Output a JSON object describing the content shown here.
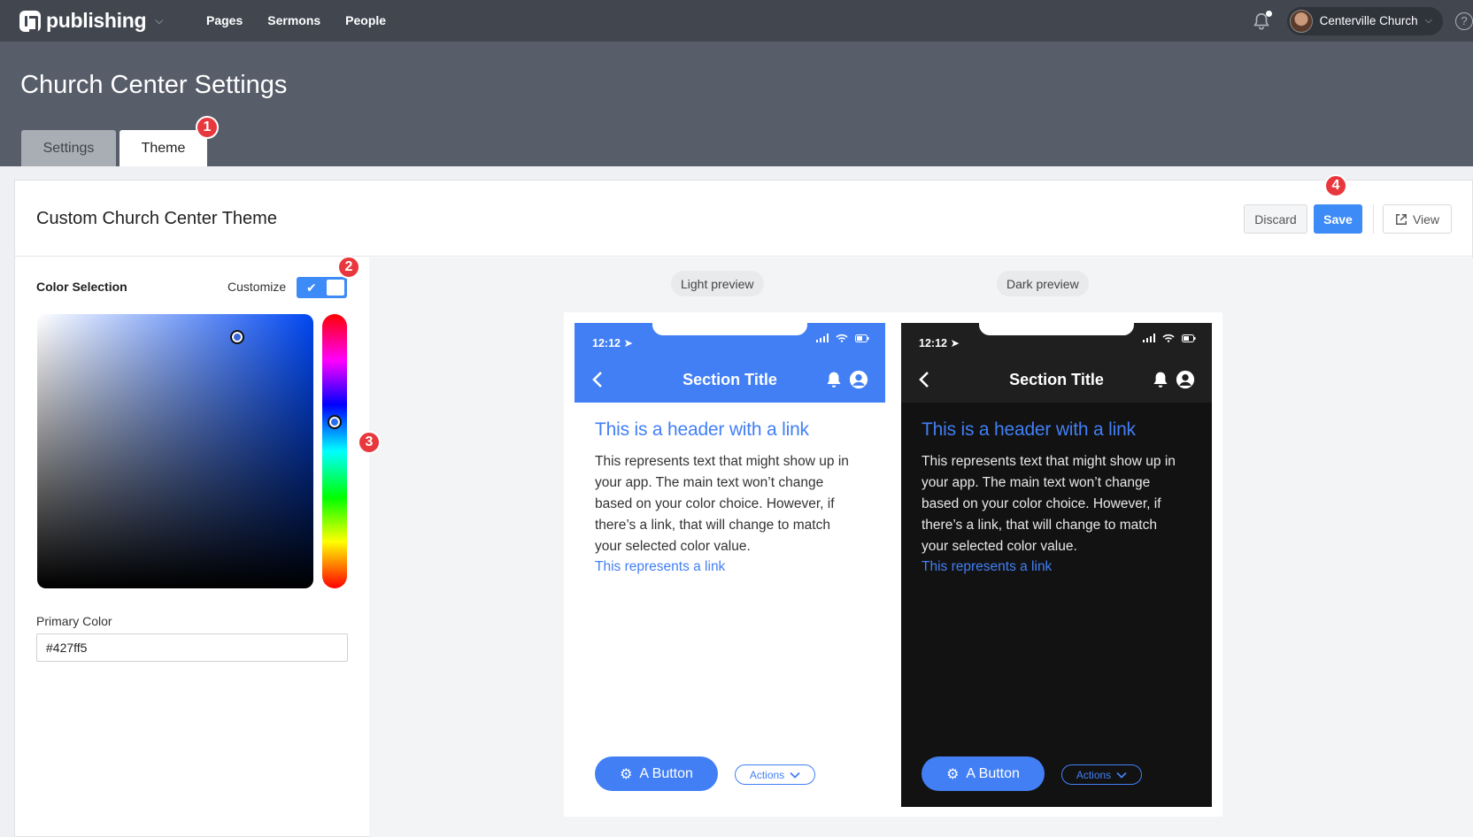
{
  "nav": {
    "brand": "publishing",
    "links": [
      "Pages",
      "Sermons",
      "People"
    ],
    "account": "Centerville Church",
    "help": "?"
  },
  "page": {
    "title": "Church Center Settings",
    "tabs": [
      "Settings",
      "Theme"
    ]
  },
  "markers": [
    "1",
    "2",
    "3",
    "4"
  ],
  "panel": {
    "title": "Custom Church Center Theme",
    "discard": "Discard",
    "save": "Save",
    "view": "View"
  },
  "colorSelection": {
    "heading": "Color Selection",
    "customize_label": "Customize",
    "customize_on": true,
    "primary_label": "Primary Color",
    "primary_value": "#427ff5"
  },
  "preview": {
    "light_label": "Light preview",
    "dark_label": "Dark preview",
    "time": "12:12",
    "section_title": "Section Title",
    "header_link": "This is a header with a link",
    "body": "This represents text that might show up in your app. The main text won’t change based on your color choice. However, if there’s a link, that will change to match your selected color value.",
    "link": "This represents a link",
    "button": "A Button",
    "actions": "Actions"
  },
  "colors": {
    "primary": "#427ff5",
    "save_button": "#3d8bf6",
    "marker": "#e8383d"
  }
}
